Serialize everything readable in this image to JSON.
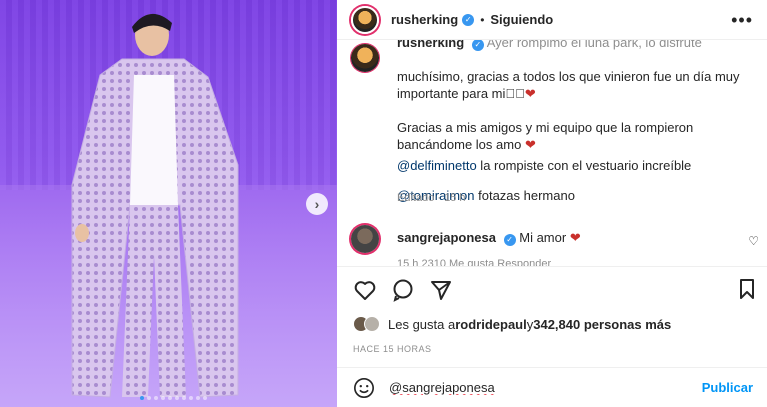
{
  "post": {
    "username": "rusherking",
    "follow_state": "Siguiendo",
    "separator": "•",
    "more": "•••"
  },
  "caption": {
    "username": "rusherking",
    "line1": "Ayer rompimo el luna park, lo disfrute",
    "line2": "muchísimo, gracias a todos los que vinieron fue un día muy importante para mi",
    "line2_suffix": "🏻🏻",
    "heart": "❤",
    "paragraph2": "Gracias a mis amigos y mi equipo que la rompieron bancándome los amo",
    "mention1": "@delfiminetto",
    "mention1_text": " la rompiste con el vestuario increíble",
    "mention2": "@tomiraimon",
    "mention2_text": " fotazas hermano",
    "edited": "Editado · 15 h"
  },
  "reply": {
    "username": "sangrejaponesa",
    "text": "Mi amor",
    "heart": "❤",
    "meta": "15 h   2310 Me gusta   Responder"
  },
  "likes": {
    "prefix": "Les gusta a ",
    "user": "rodridepaul",
    "middle": " y ",
    "count": "342,840 personas más"
  },
  "timestamp": "HACE 15 HORAS",
  "composer": {
    "value": "@sangrejaponesa",
    "publish": "Publicar"
  },
  "colors": {
    "accent": "#0095f6",
    "verified": "#3897f0",
    "heart": "#c9302c"
  },
  "carousel": {
    "slides": 10,
    "active_index": 0
  }
}
